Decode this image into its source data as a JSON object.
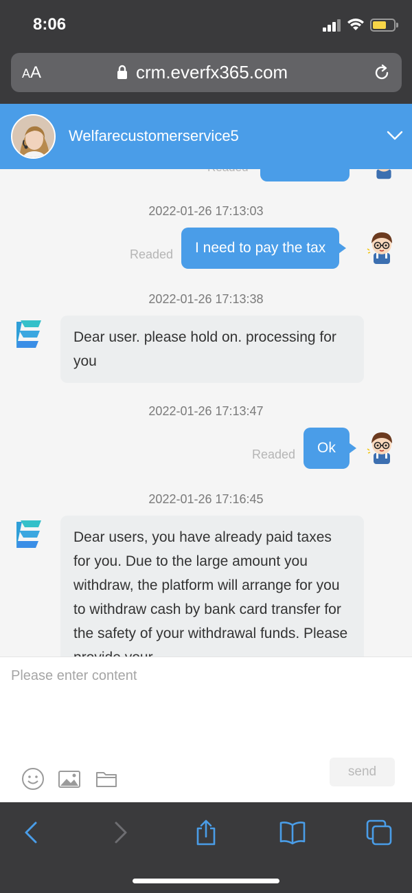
{
  "status_bar": {
    "time": "8:06"
  },
  "browser": {
    "text_size_label_small": "A",
    "text_size_label_large": "A",
    "url": "crm.everfx365.com"
  },
  "chat_header": {
    "agent_name": "Welfarecustomerservice5"
  },
  "messages": [
    {
      "type": "timestamp",
      "text": "2022-01-26 17:13:03"
    },
    {
      "type": "outgoing",
      "text": "I need to pay the tax",
      "status": "Readed"
    },
    {
      "type": "timestamp",
      "text": "2022-01-26 17:13:38"
    },
    {
      "type": "incoming",
      "text": "Dear user. please hold on. processing for you"
    },
    {
      "type": "timestamp",
      "text": "2022-01-26 17:13:47"
    },
    {
      "type": "outgoing",
      "text": "Ok",
      "status": "Readed"
    },
    {
      "type": "timestamp",
      "text": "2022-01-26 17:16:45"
    },
    {
      "type": "incoming",
      "text": "Dear users, you have already paid taxes for you. Due to the large amount you withdraw, the platform will arrange for you to withdraw cash by bank card transfer for the safety of your withdrawal funds. Please provide your"
    }
  ],
  "partial_top_status": "Readed",
  "composer": {
    "placeholder": "Please enter content",
    "send_label": "send"
  },
  "colors": {
    "accent": "#4a9de8",
    "incoming_bubble": "#eceeef",
    "safari_chrome": "#3a3a3c"
  }
}
